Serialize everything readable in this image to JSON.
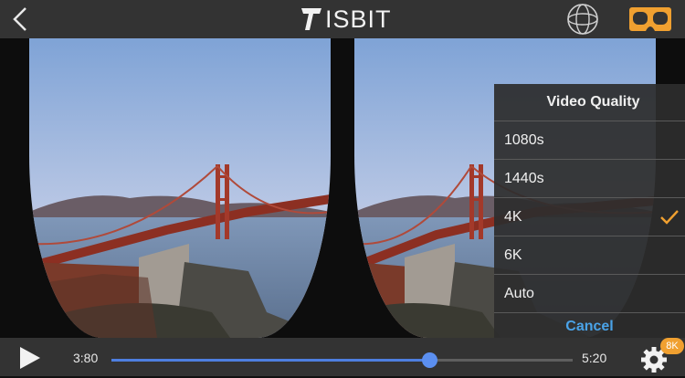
{
  "header": {
    "logo_text": "ISBIT",
    "back_icon": "chevron-left-icon",
    "view_360_icon": "globe-360-icon",
    "vr_icon": "vr-headset-icon",
    "vr_color": "#f0a030"
  },
  "quality_menu": {
    "title": "Video Quality",
    "options": [
      {
        "label": "1080s",
        "selected": false
      },
      {
        "label": "1440s",
        "selected": false
      },
      {
        "label": "4K",
        "selected": true
      },
      {
        "label": "6K",
        "selected": false
      },
      {
        "label": "Auto",
        "selected": false
      }
    ],
    "cancel_label": "Cancel",
    "accent": "#4aa3e8",
    "check_color": "#f0a030"
  },
  "player": {
    "current_time": "3:80",
    "total_time": "5:20",
    "progress": 0.69,
    "settings_badge": "8K",
    "play_icon": "play-icon",
    "settings_icon": "gear-icon",
    "accent": "#4e7fe0"
  }
}
